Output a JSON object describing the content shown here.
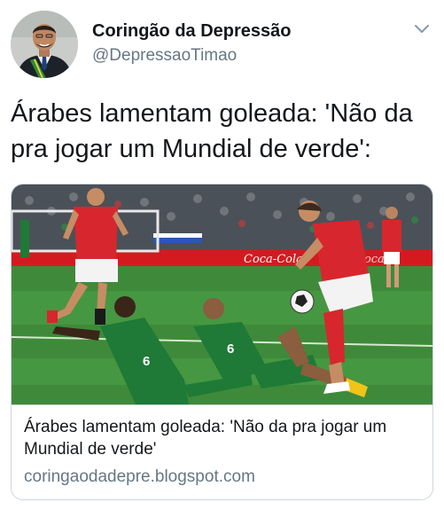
{
  "author": {
    "display_name": "Coringão da Depressão",
    "handle": "@DepressaoTimao"
  },
  "tweet": {
    "text": "Árabes lamentam goleada: 'Não da pra jogar um Mundial de verde':"
  },
  "card": {
    "title": "Árabes lamentam goleada: 'Não da pra jogar um Mundial de verde'",
    "domain": "coringaodadepre.blogspot.com",
    "image": {
      "billboard_text": "Coca-Cola",
      "player_numbers": [
        "6",
        "6"
      ]
    }
  },
  "icons": {
    "menu": "chevron-down-icon"
  },
  "colors": {
    "text": "#14171a",
    "secondary": "#657786",
    "border": "#ccd6dd",
    "pitch": "#3f8a3a",
    "billboard": "#d31b1f",
    "russia_shirt": "#d7262e",
    "saudi_shirt": "#1e7a36"
  }
}
